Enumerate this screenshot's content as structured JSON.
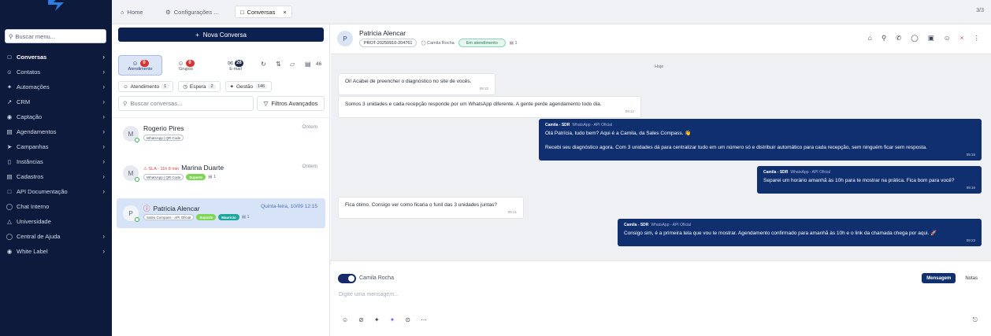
{
  "sidebar": {
    "search_placeholder": "Buscar menu...",
    "items": [
      {
        "label": "Conversas",
        "icon": "chat-bubble-icon",
        "chevron": true,
        "active": true
      },
      {
        "label": "Contatos",
        "icon": "contacts-icon",
        "chevron": true
      },
      {
        "label": "Automações",
        "icon": "automation-icon",
        "chevron": true
      },
      {
        "label": "CRM",
        "icon": "trend-icon",
        "chevron": true
      },
      {
        "label": "Captação",
        "icon": "target-icon",
        "chevron": true
      },
      {
        "label": "Agendamentos",
        "icon": "calendar-icon",
        "chevron": true
      },
      {
        "label": "Campanhas",
        "icon": "send-icon",
        "chevron": true
      },
      {
        "label": "Instâncias",
        "icon": "instances-icon",
        "chevron": true
      },
      {
        "label": "Cadastros",
        "icon": "registry-icon",
        "chevron": true
      },
      {
        "label": "API Documentação",
        "icon": "document-icon",
        "chevron": true
      },
      {
        "label": "Chat Interno",
        "icon": "chat-icon",
        "chevron": false
      },
      {
        "label": "Universidade",
        "icon": "graduation-icon",
        "chevron": false
      },
      {
        "label": "Central de Ajuda",
        "icon": "help-icon",
        "chevron": true
      },
      {
        "label": "White Label",
        "icon": "palette-icon",
        "chevron": true
      }
    ]
  },
  "tabs": [
    {
      "label": "Home",
      "icon": "home-icon"
    },
    {
      "label": "Configurações ...",
      "icon": "gear-icon"
    },
    {
      "label": "Conversas",
      "icon": "chat-bubble-icon",
      "selected": true
    }
  ],
  "page_counter": "3/3",
  "list": {
    "new_button": "Nova Conversa",
    "channels": [
      {
        "label": "Atendimento",
        "count": "0",
        "selected": true
      },
      {
        "label": "Grupos",
        "count": "0"
      },
      {
        "label": "E-mail",
        "count": "26"
      }
    ],
    "unread_count": "46",
    "filters": [
      {
        "label": "Atendimento",
        "count": "1"
      },
      {
        "label": "Espera",
        "count": "2"
      },
      {
        "label": "Gestão",
        "count": "146"
      }
    ],
    "search_placeholder": "Buscar conversas...",
    "advanced_filters": "Filtros Avançados",
    "conversations": [
      {
        "initial": "M",
        "name": "Rogerio Pires",
        "time": "Ontem",
        "tags": [
          "WhatsApp | QR Code"
        ]
      },
      {
        "initial": "M",
        "sla": "SLA - 11h 8 min",
        "name": "Marina Duarte",
        "time": "Ontem",
        "tags": [
          "WhatsApp | QR Code",
          "Suporte"
        ],
        "msg_count": "1"
      },
      {
        "initial": "P",
        "name": "Patricia Alencar",
        "time": "Quinta-feira, 10/09 12:15",
        "tags": [
          "Sales Compass - API Oficial",
          "Suporte",
          "Mauricio"
        ],
        "msg_count": "1",
        "selected": true
      }
    ]
  },
  "chat": {
    "contact_initial": "P",
    "contact_name": "Patricia Alencar",
    "protocol": "PROT-20250910-204761",
    "assigned_to": "Camila Rocha",
    "status": "Em atendimento",
    "msg_count": "1",
    "day_label": "Hoje",
    "messages": [
      {
        "dir": "in",
        "text": "Oi! Acabei de preencher o diagnóstico no site de vocês.",
        "time": "09:12"
      },
      {
        "dir": "in",
        "text": "Somos 3 unidades e cada recepção responde por um WhatsApp diferente. A gente perde agendamento todo dia.",
        "time": "09:12"
      },
      {
        "dir": "out",
        "sender": "Camila - SDR",
        "channel": "WhatsApp - API Oficial",
        "lines": [
          "Olá Patrícia, tudo bem? Aqui é a Camila, da Sales Compass. 👋",
          "",
          "Recebi seu diagnóstico agora. Com 3 unidades dá para centralizar tudo em um número só e distribuir automático para cada recepção, sem ninguém ficar sem resposta."
        ],
        "time": "09:15"
      },
      {
        "dir": "out",
        "sender": "Camila - SDR",
        "channel": "WhatsApp - API Oficial",
        "lines": [
          "Separei um horário amanhã às 10h para te mostrar na prática. Fica bom para você?"
        ],
        "time": "09:16"
      },
      {
        "dir": "in",
        "text": "Fica ótimo. Consigo ver como ficaria o funil das 3 unidades juntas?",
        "time": "09:21"
      },
      {
        "dir": "out",
        "sender": "Camila - SDR",
        "channel": "WhatsApp - API Oficial",
        "lines": [
          "Consigo sim, é a primeira tela que vou te mostrar. Agendamento confirmado para amanhã às 10h e o link da chamada chega por aqui. 🚀"
        ],
        "time": "09:23"
      }
    ],
    "compose": {
      "toggle_label": "Camila Rocha",
      "mode_message": "Mensagem",
      "mode_notes": "Notas",
      "placeholder": "Digite uma mensagem..."
    }
  },
  "colors": {
    "sidebar_bg": "#0d1a3c",
    "primary": "#0d2150",
    "outgoing_bubble": "#102f6e",
    "badge_red": "#d73232",
    "status_green": "#1c7d58"
  }
}
